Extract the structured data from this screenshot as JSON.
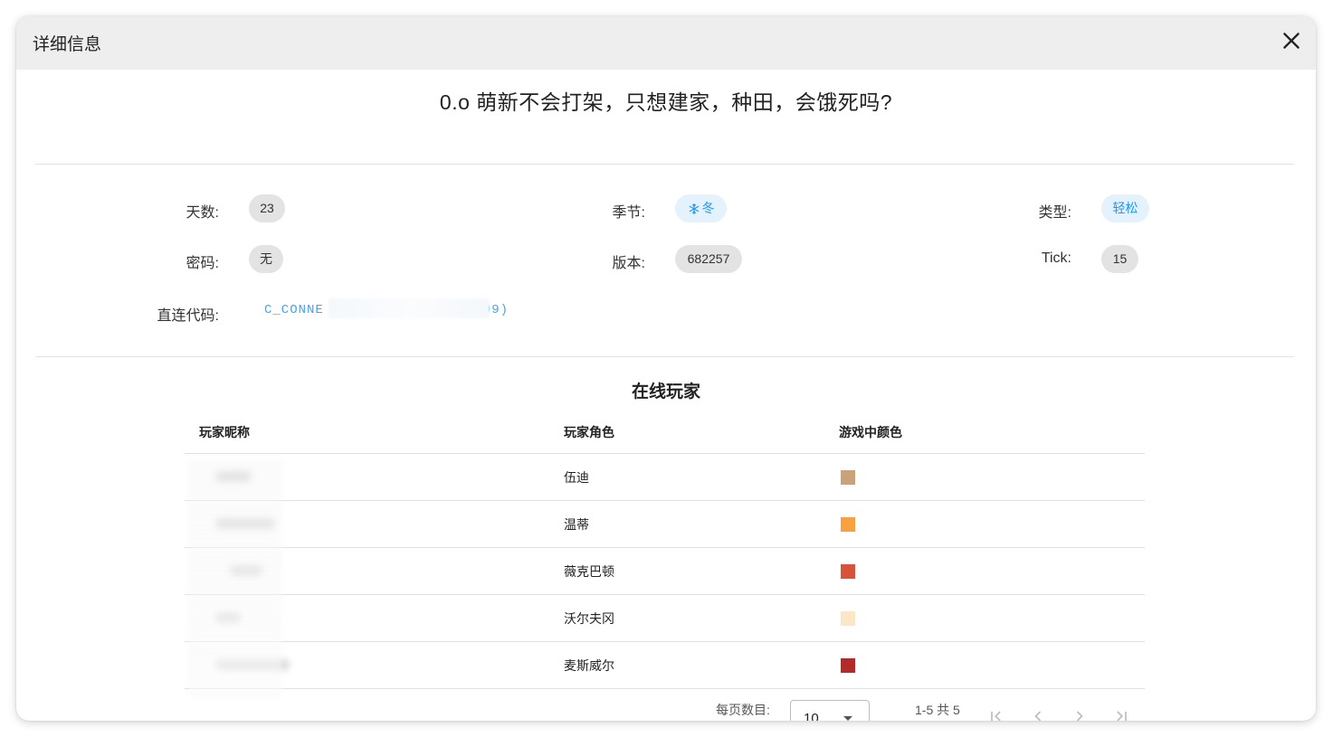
{
  "dialog": {
    "title": "详细信息"
  },
  "server": {
    "name": "0.o   萌新不会打架，只想建家，种田，会饿死吗?"
  },
  "info": {
    "days_label": "天数:",
    "days_value": "23",
    "season_label": "季节:",
    "season_value": "冬",
    "season_icon": "snowflake-icon",
    "type_label": "类型:",
    "type_value": "轻松",
    "password_label": "密码:",
    "password_value": "无",
    "version_label": "版本:",
    "version_value": "682257",
    "tick_label": "Tick:",
    "tick_value": "15",
    "connect_label": "直连代码:",
    "connect_prefix": "C_CONNE",
    "connect_suffix": "99)"
  },
  "players": {
    "title": "在线玩家",
    "columns": [
      "玩家昵称",
      "玩家角色",
      "游戏中颜色"
    ],
    "rows": [
      {
        "character": "伍迪",
        "color": "#c9a27a"
      },
      {
        "character": "温蒂",
        "color": "#f9a040"
      },
      {
        "character": "薇克巴顿",
        "color": "#d9533b"
      },
      {
        "character": "沃尔夫冈",
        "color": "#fbe6c8"
      },
      {
        "character": "麦斯威尔",
        "color": "#b22a2a"
      }
    ]
  },
  "pagination": {
    "rows_per_page_label": "每页数目:",
    "rows_per_page_value": "10",
    "range_text": "1-5 共 5"
  },
  "colors": {
    "accent": "#2196f3",
    "chip_bg": "#e3e3e3",
    "header_bg": "#eeeeee"
  }
}
